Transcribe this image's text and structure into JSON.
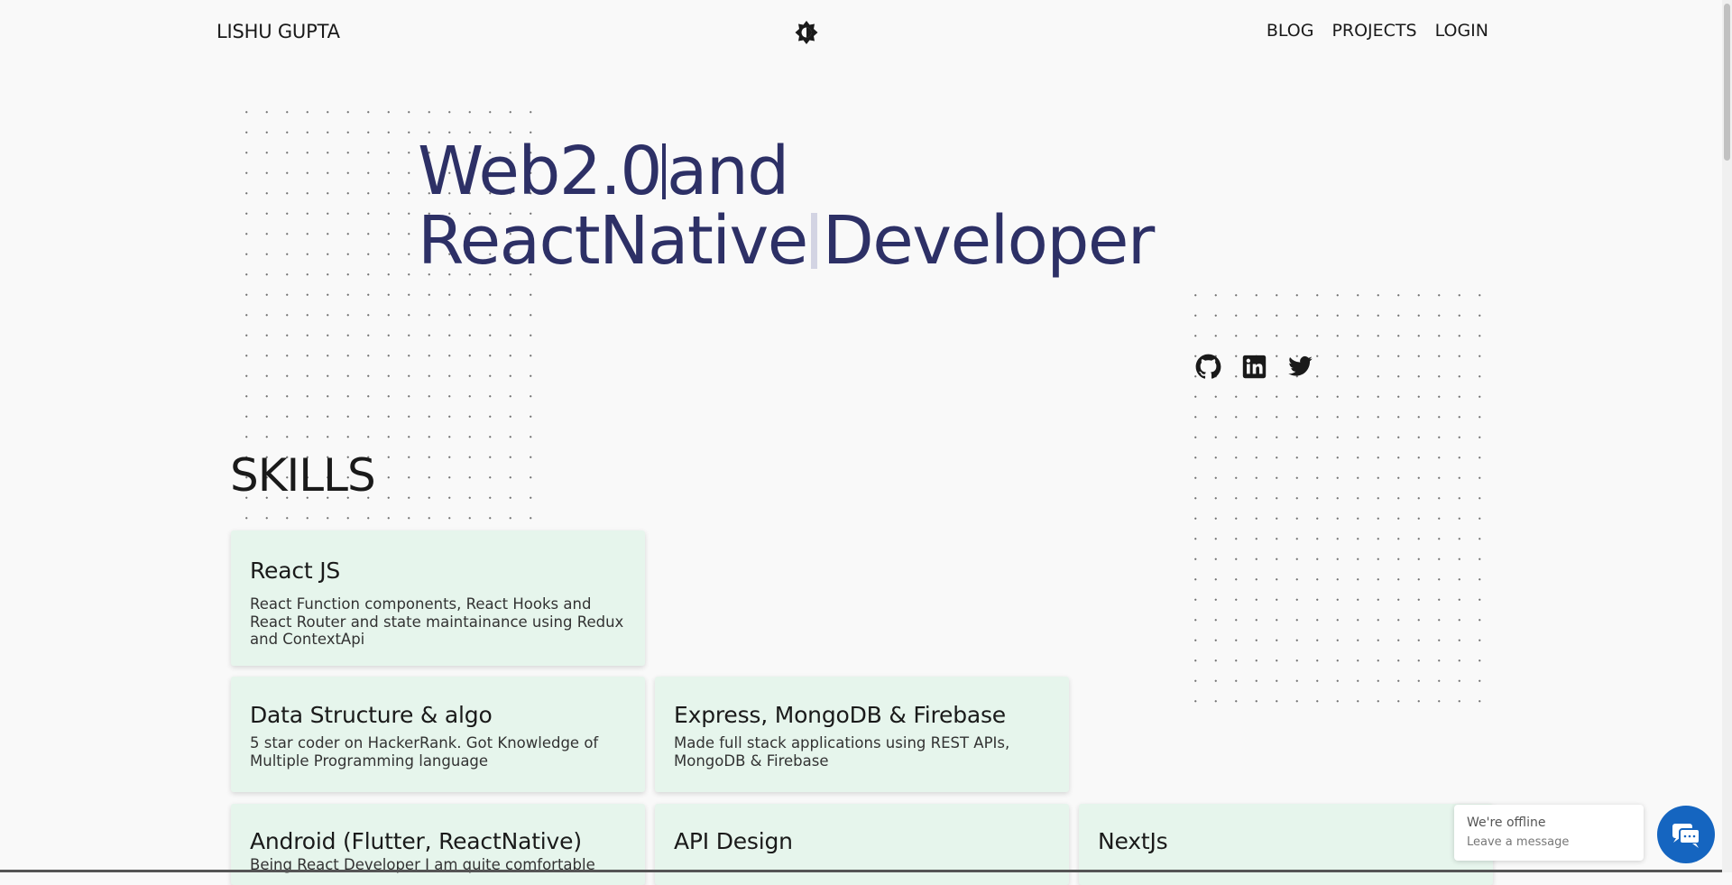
{
  "nav": {
    "brand": "LISHU GUPTA",
    "theme_toggle_icon": "brightness-toggle-icon",
    "links": [
      "BLOG",
      "PROJECTS",
      "LOGIN"
    ]
  },
  "hero": {
    "line1": "Web2.0",
    "line1_end": "and",
    "line2": "ReactNative",
    "line2_end": "Developer"
  },
  "social": {
    "icons": [
      "github-icon",
      "linkedin-icon",
      "twitter-icon"
    ]
  },
  "skills": {
    "title": "SKILLS",
    "cards": [
      {
        "title": "React JS",
        "desc": "React Function components, React Hooks and React Router and state maintainance using Redux and ContextApi"
      },
      {
        "title": "Data Structure & algo",
        "desc": "5 star coder on HackerRank. Got Knowledge of Multiple Programming language"
      },
      {
        "title": "Express, MongoDB & Firebase",
        "desc": "Made full stack applications using REST APIs, MongoDB & Firebase"
      },
      {
        "title": "Android (Flutter, ReactNative)",
        "desc": "Being React Developer I am quite comfortable"
      },
      {
        "title": "API Design",
        "desc": ""
      },
      {
        "title": "NextJs",
        "desc": ""
      }
    ]
  },
  "chat": {
    "status": "We're offline",
    "prompt": "Leave a message"
  },
  "colors": {
    "heading": "#2d3066",
    "card_bg": "#e6f5ec",
    "chat_button": "#1565c0",
    "page_bg": "#f9f9f9"
  }
}
